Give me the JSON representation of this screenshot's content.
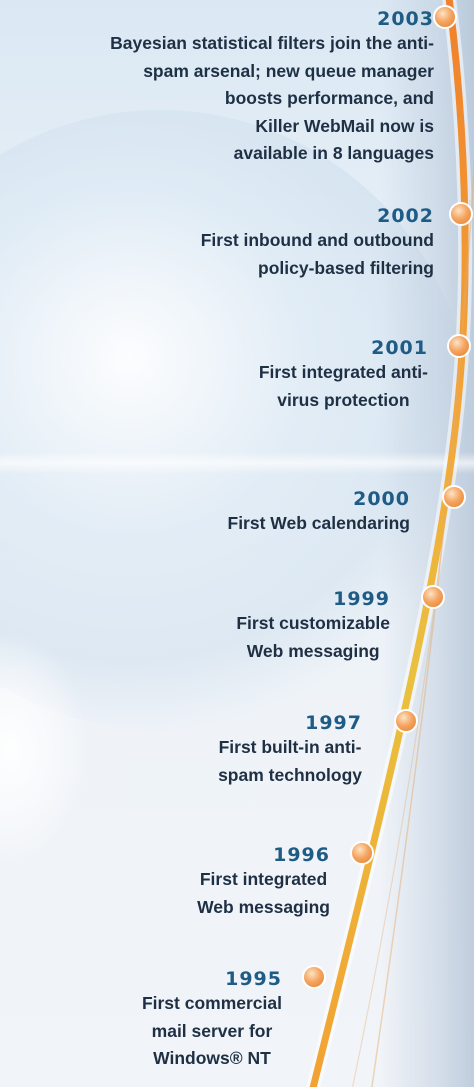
{
  "timeline": {
    "milestones": [
      {
        "year": "2003",
        "text": "Bayesian statistical filters join the anti-\nspam arsenal; new queue manager\nboosts performance, and\nKiller WebMail now is\navailable in 8 languages"
      },
      {
        "year": "2002",
        "text": "First inbound and outbound\npolicy-based filtering"
      },
      {
        "year": "2001",
        "text": "First integrated anti-\nvirus protection"
      },
      {
        "year": "2000",
        "text": "First Web calendaring"
      },
      {
        "year": "1999",
        "text": "First customizable\nWeb messaging"
      },
      {
        "year": "1997",
        "text": "First built-in anti-\nspam technology"
      },
      {
        "year": "1996",
        "text": "First integrated\nWeb messaging"
      },
      {
        "year": "1995",
        "text": "First commercial\nmail server for\nWindows® NT"
      }
    ]
  },
  "colors": {
    "year_text": "#1e5c86",
    "body_text": "#1f3045",
    "curve_top": "#f08a2c",
    "curve_mid": "#f2b73a",
    "curve_bottom": "#f4a435",
    "marker": "#f2a055"
  }
}
